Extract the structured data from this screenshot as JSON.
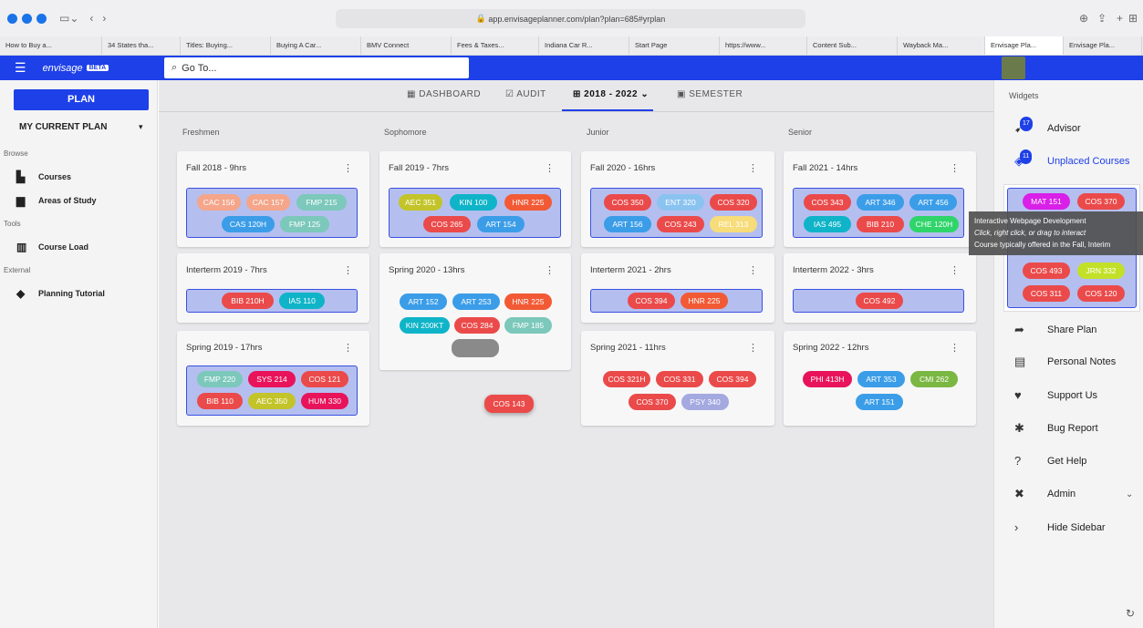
{
  "browser": {
    "url": "app.envisageplanner.com/plan?plan=685#yrplan",
    "bookmarks": [
      "How to Buy a...",
      "34 States tha...",
      "Titles: Buying...",
      "Buying A Car...",
      "BMV Connect",
      "Fees & Taxes...",
      "Indiana Car R...",
      "Start Page",
      "https://www...",
      "Content Sub...",
      "Wayback Ma...",
      "Envisage Pla...",
      "Envisage Pla..."
    ]
  },
  "appbar": {
    "logo": "envisage",
    "beta": "BETA",
    "search_placeholder": "Go To..."
  },
  "left": {
    "plan_button": "PLAN",
    "current_plan": "MY CURRENT PLAN",
    "browse": "Browse",
    "courses": "Courses",
    "areas": "Areas of Study",
    "tools": "Tools",
    "course_load": "Course Load",
    "external": "External",
    "tutorial": "Planning Tutorial"
  },
  "tabs": {
    "dashboard": "DASHBOARD",
    "audit": "AUDIT",
    "years": "2018 - 2022",
    "semester": "SEMESTER"
  },
  "years": [
    "Freshmen",
    "Sophomore",
    "Junior",
    "Senior"
  ],
  "cards": {
    "f18": "Fall 2018 - 9hrs",
    "i19": "Interterm 2019 - 7hrs",
    "s19": "Spring 2019 - 17hrs",
    "f19": "Fall 2019 - 7hrs",
    "s20": "Spring 2020 - 13hrs",
    "f20": "Fall 2020 - 16hrs",
    "i21": "Interterm 2021 - 2hrs",
    "s21": "Spring 2021 - 11hrs",
    "f21": "Fall 2021 - 14hrs",
    "i22": "Interterm 2022 - 3hrs",
    "s22": "Spring 2022 - 12hrs"
  },
  "courses": {
    "c1": "CAC 156",
    "c2": "CAC 157",
    "c3": "FMP 215",
    "c4": "CAS 120H",
    "c5": "FMP 125",
    "c6": "BIB 210H",
    "c7": "IAS 110",
    "c8": "FMP 220",
    "c9": "SYS 214",
    "c10": "COS 121",
    "c11": "BIB 110",
    "c12": "AEC 350",
    "c13": "HUM 330",
    "c14": "AEC 351",
    "c15": "KIN 100",
    "c16": "HNR 225",
    "c17": "COS 265",
    "c18": "ART 154",
    "c19": "ART 152",
    "c20": "ART 253",
    "c21": "HNR 225",
    "c22": "KIN 200KT",
    "c23": "COS 284",
    "c24": "FMP 185",
    "c25": "COS 350",
    "c26": "ENT 320",
    "c27": "COS 320",
    "c28": "ART 156",
    "c29": "COS 243",
    "c30": "REL 313",
    "c31": "COS 394",
    "c32": "HNR 225",
    "c33": "COS 321H",
    "c34": "COS 331",
    "c35": "COS 394",
    "c36": "COS 370",
    "c37": "PSY 340",
    "c38": "COS 343",
    "c39": "ART 346",
    "c40": "ART 456",
    "c41": "IAS 495",
    "c42": "BIB 210",
    "c43": "CHE 120H",
    "c44": "COS 492",
    "c45": "PHI 413H",
    "c46": "ART 353",
    "c47": "CMI 262",
    "c48": "ART 151",
    "drag": "COS 143"
  },
  "widgets": {
    "title": "Widgets",
    "advisor": "Advisor",
    "advisor_count": "17",
    "unplaced": "Unplaced Courses",
    "unplaced_count": "11",
    "u1": "MAT 151",
    "u2": "COS 370",
    "u3": "COS 493",
    "u4": "JRN 332",
    "u5": "COS 311",
    "u6": "COS 120",
    "share": "Share Plan",
    "notes": "Personal Notes",
    "support": "Support Us",
    "bug": "Bug Report",
    "help": "Get Help",
    "admin": "Admin",
    "hide": "Hide Sidebar"
  },
  "tooltip": {
    "line1": "Interactive Webpage Development",
    "line2": "Click, right click, or drag to interact",
    "line3": "Course typically offered in the Fall, Interim"
  }
}
